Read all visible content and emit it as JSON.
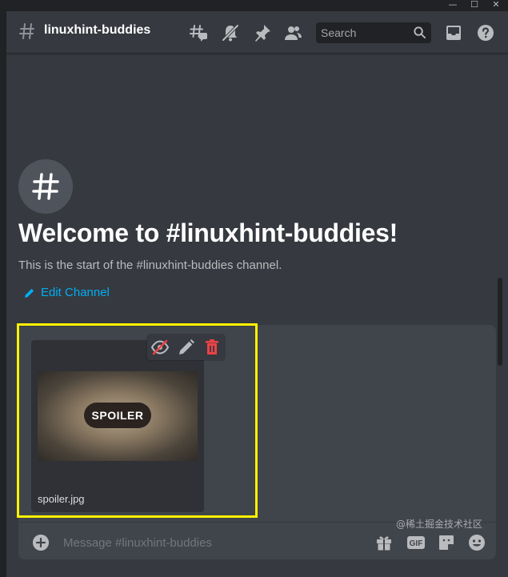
{
  "window_controls": {
    "minimize": "—",
    "maximize": "☐",
    "close": "✕"
  },
  "header": {
    "channel_name": "linuxhint-buddies",
    "icons": [
      "threads-icon",
      "notification-muted-icon",
      "pin-icon",
      "members-icon",
      "inbox-icon",
      "help-icon"
    ],
    "search": {
      "placeholder": "Search"
    }
  },
  "welcome": {
    "title": "Welcome to #linuxhint-buddies!",
    "subtitle": "This is the start of the #linuxhint-buddies channel.",
    "edit_label": "Edit Channel"
  },
  "attachment": {
    "filename": "spoiler.jpg",
    "spoiler_label": "SPOILER",
    "actions": [
      "spoiler-toggle-icon",
      "edit-icon",
      "delete-icon"
    ]
  },
  "composer": {
    "placeholder": "Message #linuxhint-buddies",
    "gif_label": "GIF",
    "icons": [
      "add-icon",
      "gift-icon",
      "gif-icon",
      "sticker-icon",
      "emoji-icon"
    ]
  },
  "watermark": "@稀土掘金技术社区",
  "colors": {
    "background": "#36393f",
    "input_bg": "#40444b",
    "accent_link": "#00aff4",
    "highlight": "#fff200",
    "danger": "#ed4245"
  }
}
